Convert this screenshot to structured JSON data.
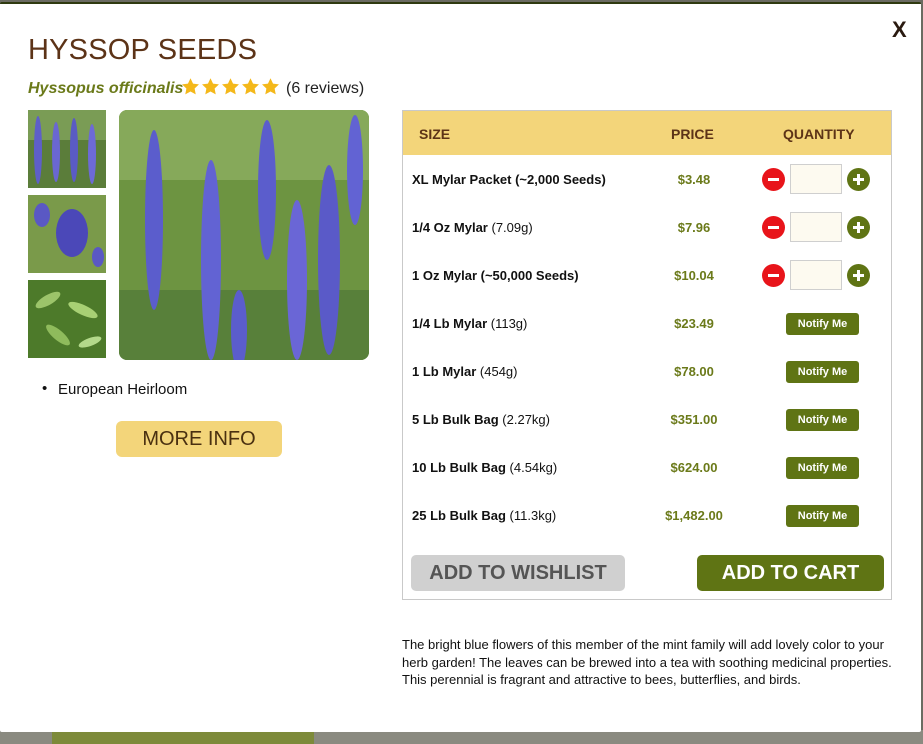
{
  "product": {
    "title": "HYSSOP SEEDS",
    "latin_name": "Hyssopus officinalis",
    "rating": 5,
    "reviews_label": "(6 reviews)",
    "features": [
      "European Heirloom"
    ],
    "more_info_label": "MORE INFO",
    "description": "The bright blue flowers of this member of the mint family will add lovely color to your herb garden! The leaves can be brewed into a tea with soothing medicinal properties. This perennial is fragrant and attractive to bees, butterflies, and birds."
  },
  "modal": {
    "close_label": "X"
  },
  "table": {
    "headers": {
      "size": "SIZE",
      "price": "PRICE",
      "quantity": "QUANTITY"
    },
    "rows": [
      {
        "size_bold": "XL Mylar Packet (~2,000 Seeds)",
        "size_rest": "",
        "price": "$3.48",
        "type": "qty",
        "quantity": ""
      },
      {
        "size_bold": "1/4 Oz Mylar",
        "size_rest": " (7.09g)",
        "price": "$7.96",
        "type": "qty",
        "quantity": ""
      },
      {
        "size_bold": "1 Oz Mylar (~50,000 Seeds)",
        "size_rest": "",
        "price": "$10.04",
        "type": "qty",
        "quantity": ""
      },
      {
        "size_bold": "1/4 Lb Mylar",
        "size_rest": " (113g)",
        "price": "$23.49",
        "type": "notify",
        "notify_label": "Notify Me"
      },
      {
        "size_bold": "1 Lb Mylar",
        "size_rest": " (454g)",
        "price": "$78.00",
        "type": "notify",
        "notify_label": "Notify Me"
      },
      {
        "size_bold": "5 Lb Bulk Bag",
        "size_rest": " (2.27kg)",
        "price": "$351.00",
        "type": "notify",
        "notify_label": "Notify Me"
      },
      {
        "size_bold": "10 Lb Bulk Bag",
        "size_rest": " (4.54kg)",
        "price": "$624.00",
        "type": "notify",
        "notify_label": "Notify Me"
      },
      {
        "size_bold": "25 Lb Bulk Bag",
        "size_rest": " (11.3kg)",
        "price": "$1,482.00",
        "type": "notify",
        "notify_label": "Notify Me"
      }
    ],
    "wishlist_label": "ADD TO WISHLIST",
    "cart_label": "ADD TO CART"
  },
  "colors": {
    "accent_green": "#5f7414",
    "header_yellow": "#f3d57a",
    "title_brown": "#5c3317",
    "star_gold": "#f4b81a",
    "minus_red": "#e8141a"
  }
}
